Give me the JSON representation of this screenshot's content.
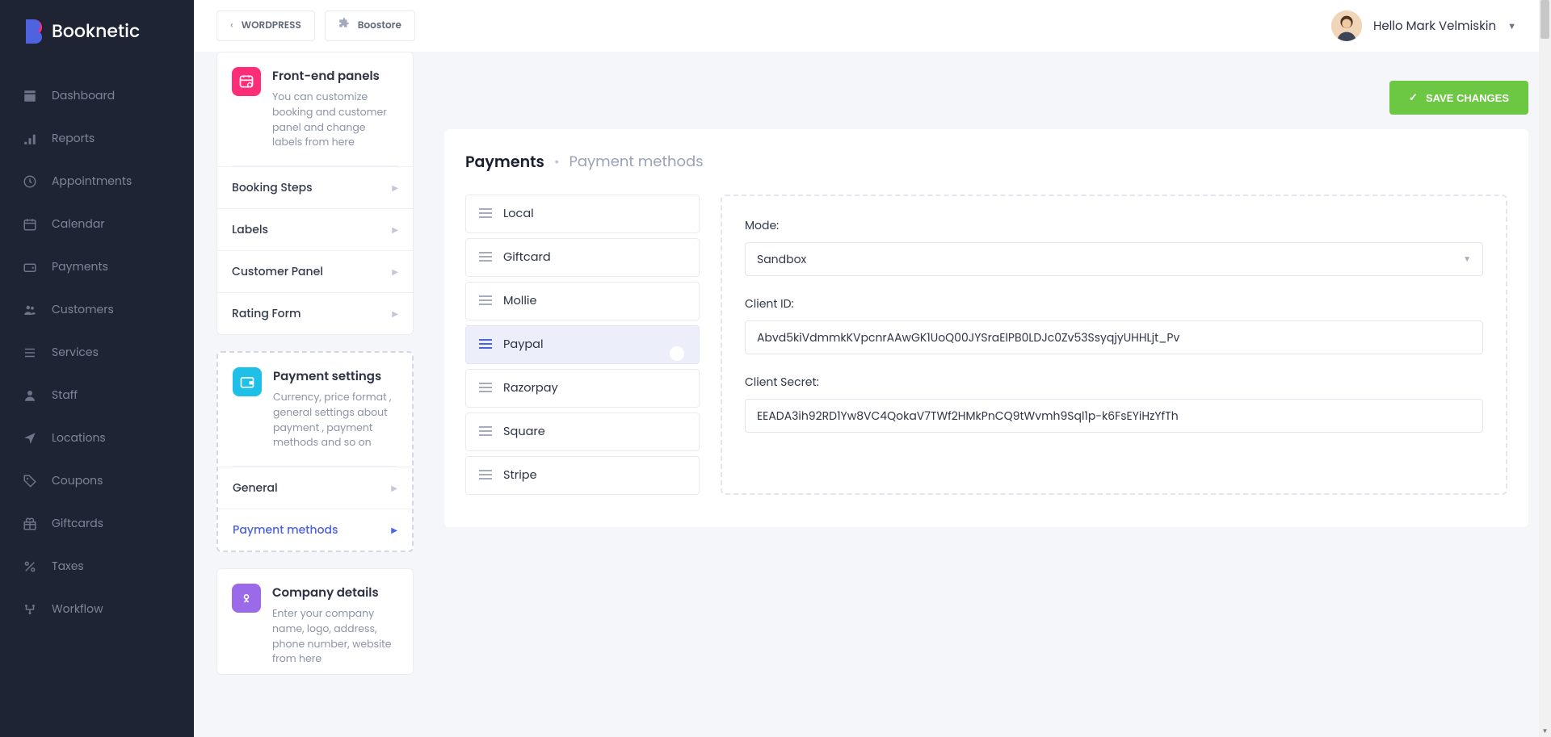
{
  "app": {
    "name": "Booknetic"
  },
  "header": {
    "tabs": [
      {
        "label": "WORDPRESS",
        "icon": "chevron-left"
      },
      {
        "label": "Boostore",
        "icon": "puzzle"
      }
    ],
    "greeting": "Hello Mark Velmiskin"
  },
  "nav": [
    {
      "label": "Dashboard",
      "icon": "box"
    },
    {
      "label": "Reports",
      "icon": "chart"
    },
    {
      "label": "Appointments",
      "icon": "clock"
    },
    {
      "label": "Calendar",
      "icon": "calendar"
    },
    {
      "label": "Payments",
      "icon": "wallet"
    },
    {
      "label": "Customers",
      "icon": "users"
    },
    {
      "label": "Services",
      "icon": "list"
    },
    {
      "label": "Staff",
      "icon": "person"
    },
    {
      "label": "Locations",
      "icon": "send"
    },
    {
      "label": "Coupons",
      "icon": "tag"
    },
    {
      "label": "Giftcards",
      "icon": "gift"
    },
    {
      "label": "Taxes",
      "icon": "percent"
    },
    {
      "label": "Workflow",
      "icon": "flow"
    }
  ],
  "settings": {
    "cards": [
      {
        "icon": "pink",
        "title": "Front-end panels",
        "desc": "You can customize booking and customer panel and change labels from here",
        "rows": [
          "Booking Steps",
          "Labels",
          "Customer Panel",
          "Rating Form"
        ],
        "active": null,
        "dashed": false
      },
      {
        "icon": "cyan",
        "title": "Payment settings",
        "desc": "Currency, price format , general settings about payment , payment methods and so on",
        "rows": [
          "General",
          "Payment methods"
        ],
        "active": 1,
        "dashed": true
      },
      {
        "icon": "purple",
        "title": "Company details",
        "desc": "Enter your company name, logo, address, phone number, website from here",
        "rows": [],
        "active": null,
        "dashed": false
      }
    ]
  },
  "main": {
    "save_label": "SAVE CHANGES",
    "bc_main": "Payments",
    "bc_sub": "Payment methods",
    "methods": [
      {
        "label": "Local",
        "enabled": true
      },
      {
        "label": "Giftcard",
        "enabled": true
      },
      {
        "label": "Mollie",
        "enabled": true
      },
      {
        "label": "Paypal",
        "enabled": true,
        "active": true
      },
      {
        "label": "Razorpay",
        "enabled": true
      },
      {
        "label": "Square",
        "enabled": true
      },
      {
        "label": "Stripe",
        "enabled": true
      }
    ],
    "details": {
      "mode_label": "Mode:",
      "mode_value": "Sandbox",
      "client_id_label": "Client ID:",
      "client_id_value": "Abvd5kiVdmmkKVpcnrAAwGK1UoQ00JYSraElPB0LDJc0Zv53SsyqjyUHHLjt_Pv",
      "client_secret_label": "Client Secret:",
      "client_secret_value": "EEADA3ih92RD1Yw8VC4QokaV7TWf2HMkPnCQ9tWvmh9Sql1p-k6FsEYiHzYfTh"
    }
  }
}
